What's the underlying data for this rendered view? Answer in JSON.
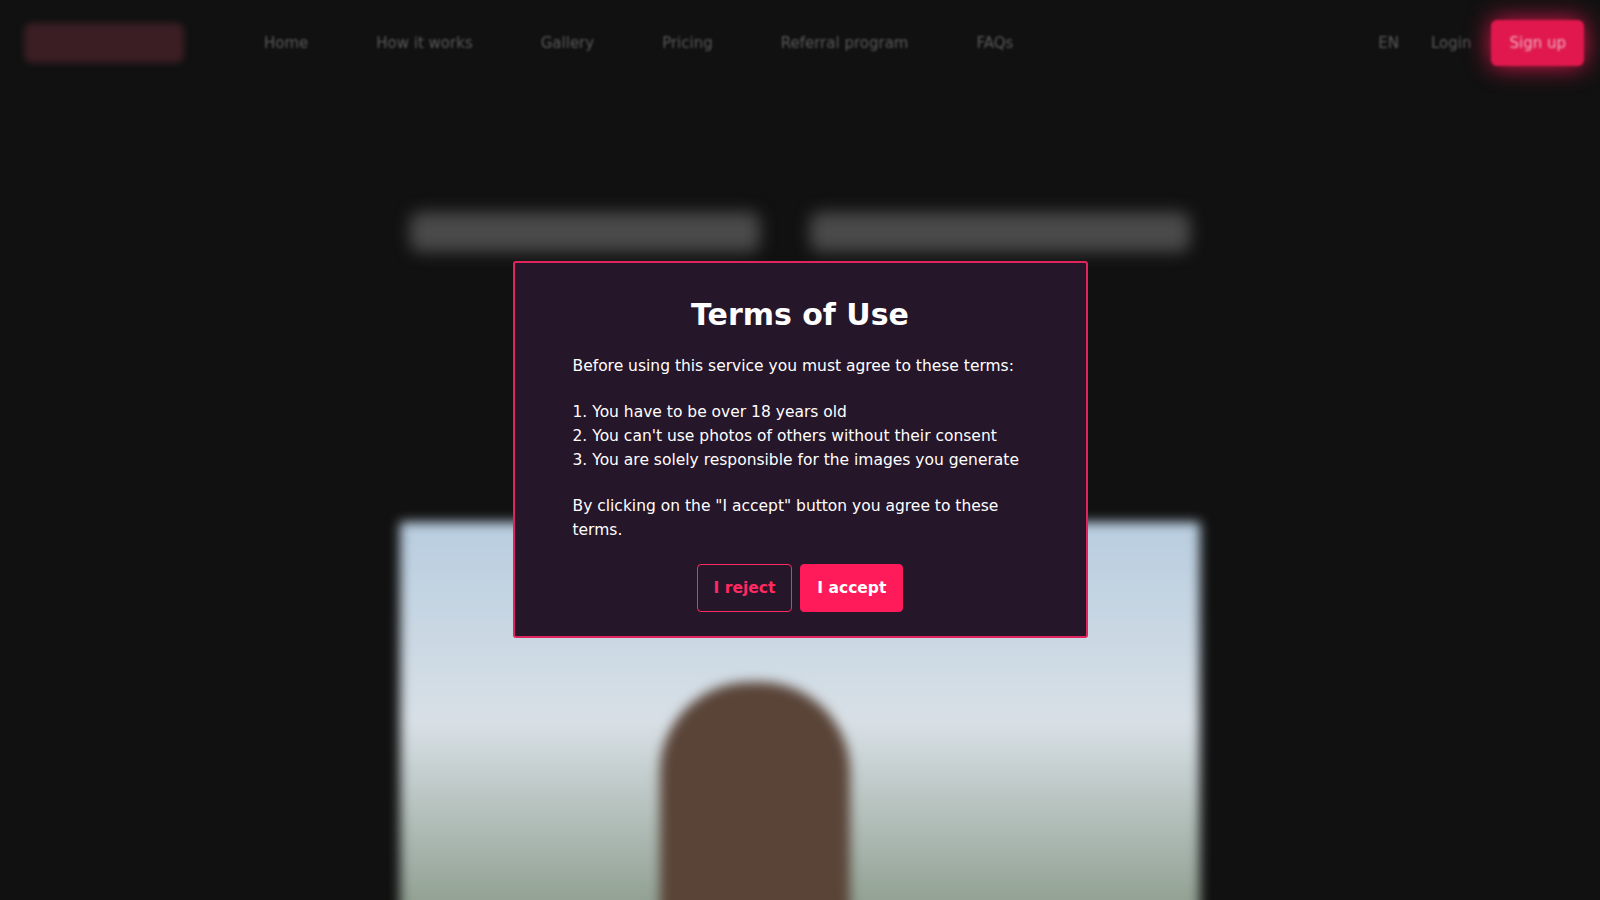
{
  "header": {
    "nav": [
      "Home",
      "How it works",
      "Gallery",
      "Pricing",
      "Referral program",
      "FAQs"
    ],
    "language": "EN",
    "login": "Login",
    "signup": "Sign up"
  },
  "modal": {
    "title": "Terms of Use",
    "intro": "Before using this service you must agree to these terms:",
    "terms": [
      {
        "number": "1.",
        "text": "You have to be over 18 years old"
      },
      {
        "number": "2.",
        "text": "You can't use photos of others without their consent"
      },
      {
        "number": "3.",
        "text": "You are solely responsible for the images you generate"
      }
    ],
    "closing": "By clicking on the \"I accept\" button you agree to these terms.",
    "buttons": [
      {
        "label": "I reject",
        "kind": "outline"
      },
      {
        "label": "I accept",
        "kind": "filled"
      }
    ]
  }
}
